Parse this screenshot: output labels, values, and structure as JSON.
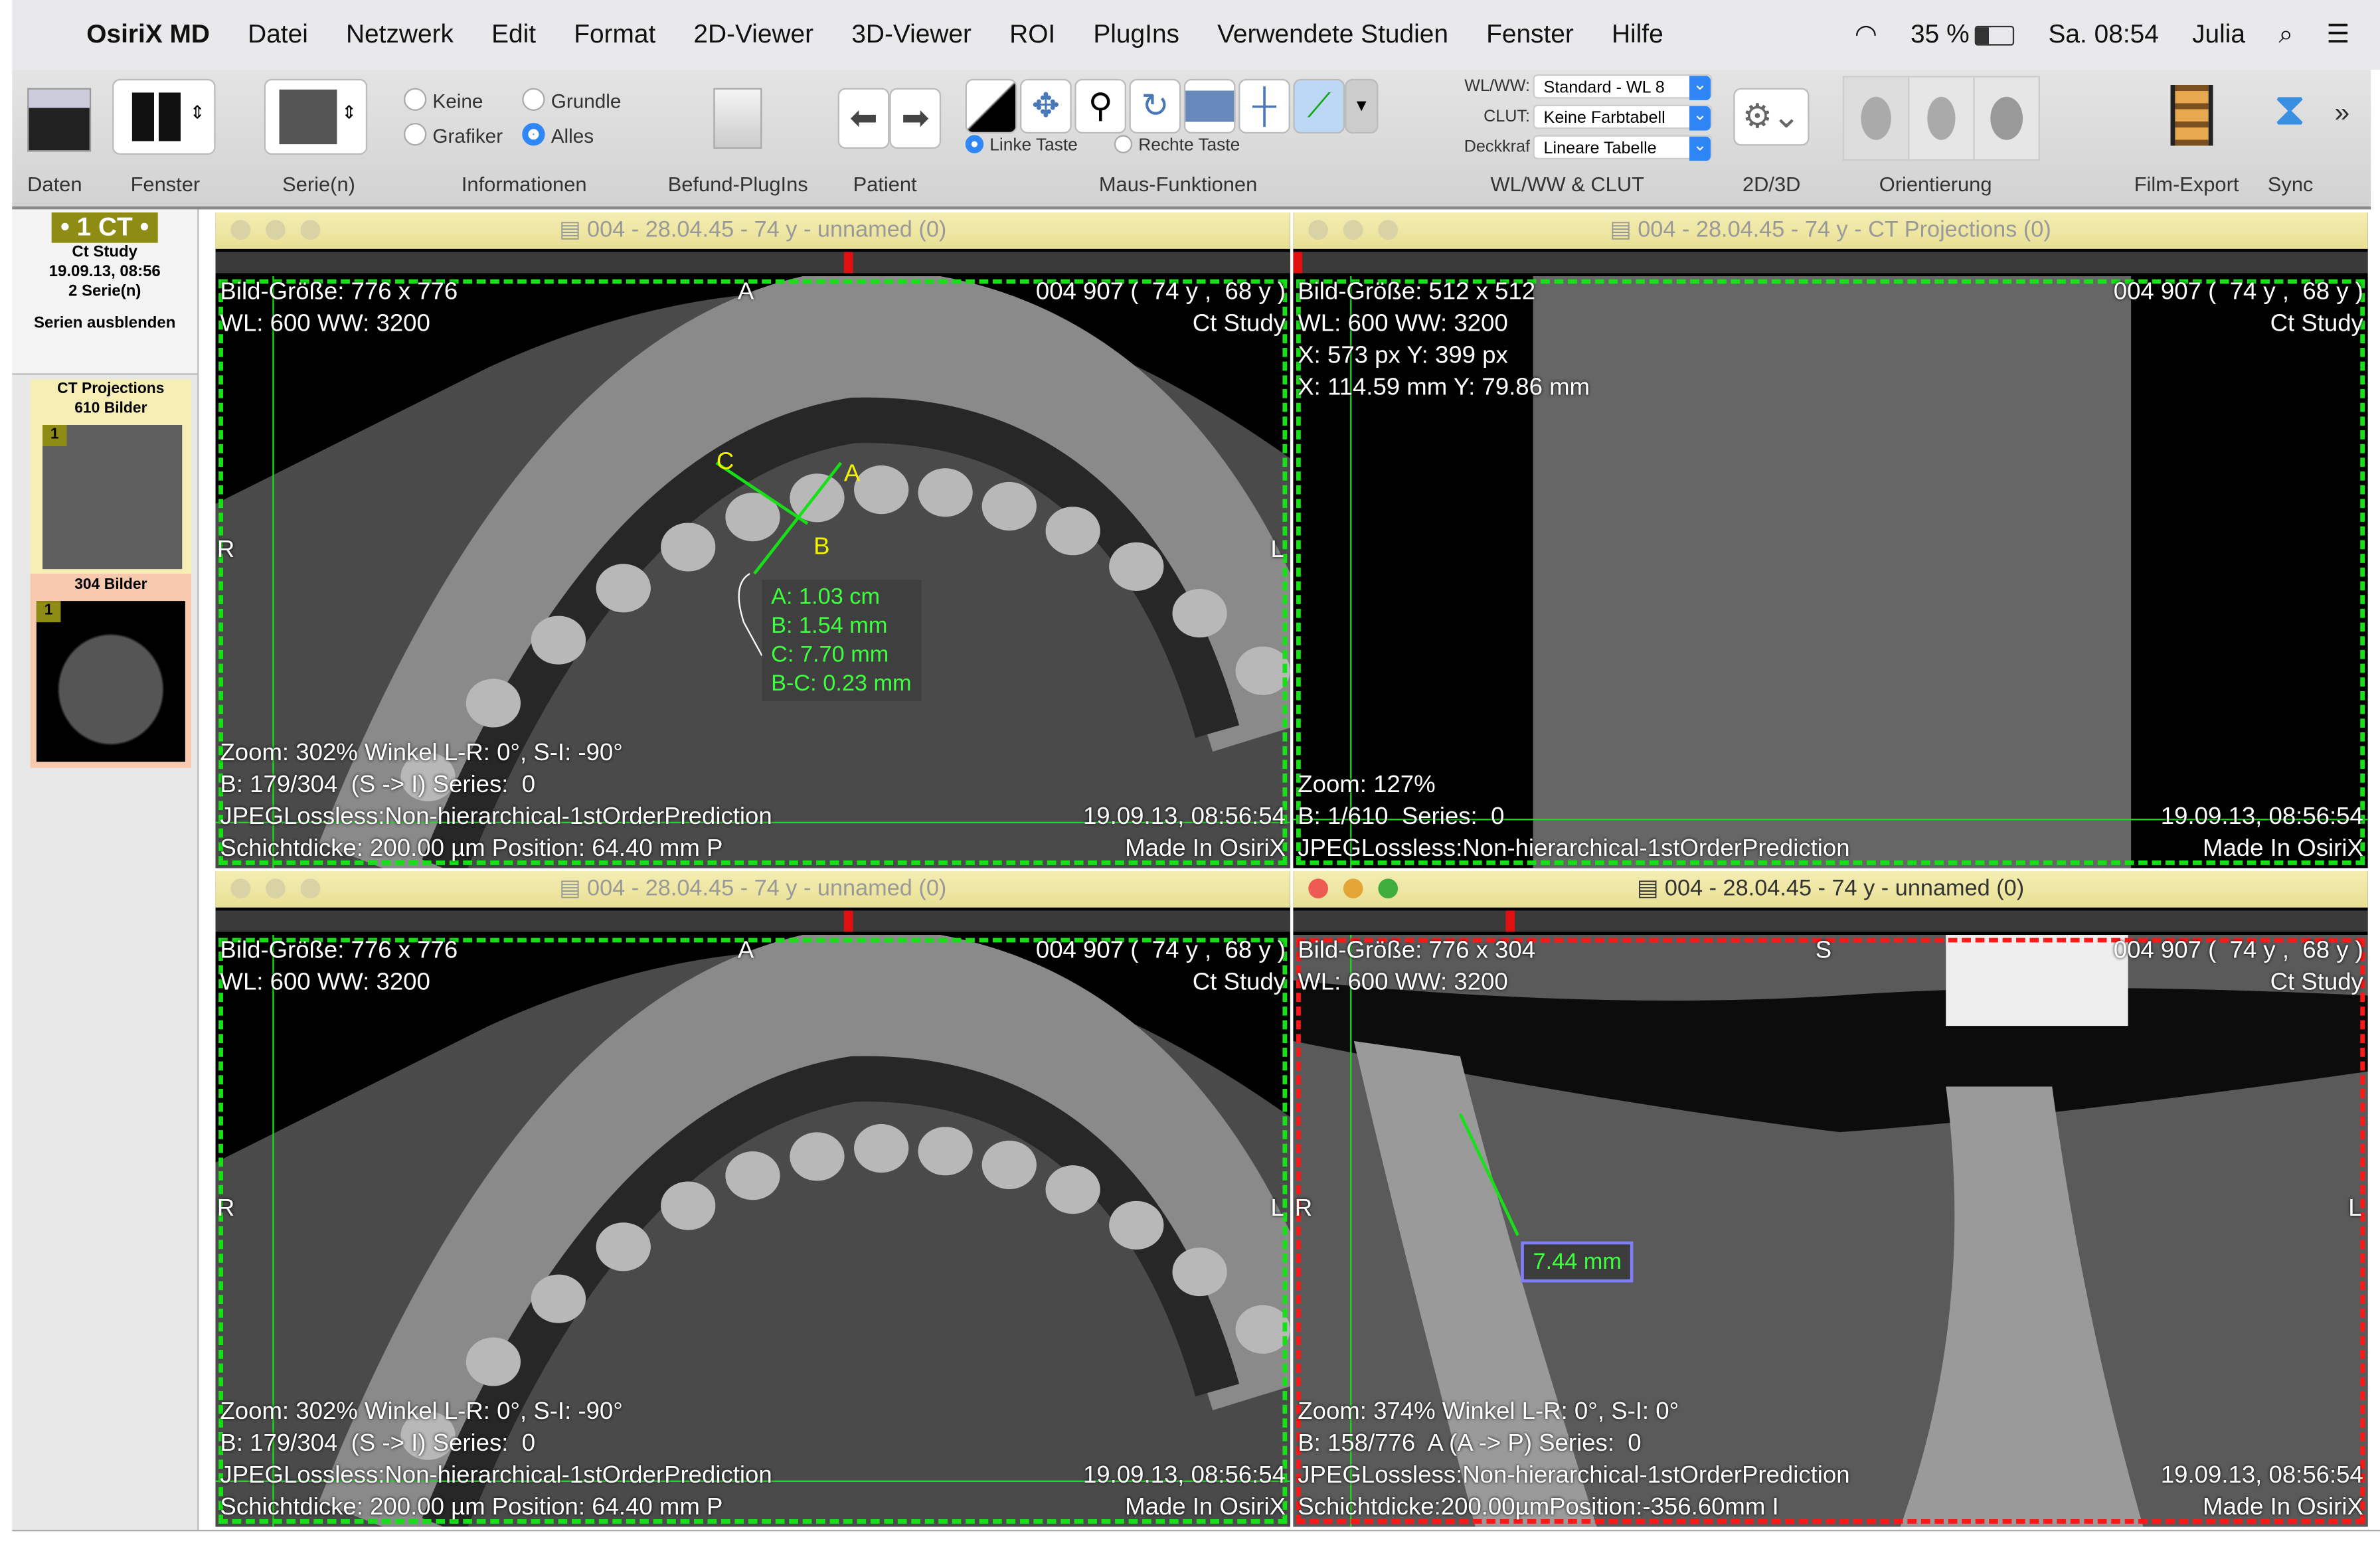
{
  "menubar": {
    "app": "OsiriX MD",
    "items": [
      "Datei",
      "Netzwerk",
      "Edit",
      "Format",
      "2D-Viewer",
      "3D-Viewer",
      "ROI",
      "PlugIns",
      "Verwendete Studien",
      "Fenster",
      "Hilfe"
    ],
    "battery": "35 %",
    "clock": "Sa. 08:54",
    "user": "Julia"
  },
  "toolbar": {
    "labels": [
      "Daten",
      "Fenster",
      "Serie(n)",
      "Informationen",
      "Befund-PlugIns",
      "Patient",
      "Maus-Funktionen",
      "WL/WW & CLUT",
      "2D/3D",
      "Orientierung",
      "Film-Export",
      "Sync"
    ],
    "info_radios": {
      "keine": "Keine",
      "grundle": "Grundle",
      "grafiker": "Grafiker",
      "alles": "Alles",
      "selected": "Alles"
    },
    "mouse_radios": {
      "left": "Linke Taste",
      "right": "Rechte Taste",
      "selected": "Linke Taste"
    },
    "wlww": {
      "wl_label": "WL/WW:",
      "wl_value": "Standard - WL 8",
      "clut_label": "CLUT:",
      "clut_value": "Keine Farbtabell",
      "opacity_label": "Deckkraf",
      "opacity_value": "Lineare Tabelle"
    },
    "more": "»"
  },
  "sidebar": {
    "badge": "• 1 CT •",
    "study": "Ct Study",
    "date": "19.09.13, 08:56",
    "series_count": "2 Serie(n)",
    "hide": "Serien ausblenden",
    "series": [
      {
        "name": "CT Projections",
        "count": "610 Bilder",
        "num": "1"
      },
      {
        "name": "",
        "count": "304 Bilder",
        "num": "1"
      }
    ]
  },
  "viewers": [
    {
      "title": "004 - 28.04.45 - 74 y - unnamed (0)",
      "active": false,
      "kind": "axial",
      "tl": "Bild-Größe: 776 x 776\nWL: 600 WW: 3200",
      "tr": "004 907 (  74 y ,  68 y )\nCt Study",
      "bl": "Zoom: 302% Winkel L-R: 0°, S-I: -90°\nB: 179/304  (S -> I) Series:  0\nJPEGLossless:Non-hierarchical-1stOrderPrediction\nSchichtdicke: 200.00 µm Position: 64.40 mm P",
      "br": "19.09.13, 08:56:54\nMade In OsiriX",
      "top": "A",
      "left": "R",
      "right": "L",
      "measure": "A: 1.03 cm\nB: 1.54 mm\nC: 7.70 mm\nB-C: 0.23 mm",
      "points": [
        "A",
        "B",
        "C"
      ]
    },
    {
      "title": "004 - 28.04.45 - 74 y - CT Projections (0)",
      "active": false,
      "kind": "proj",
      "tl": "Bild-Größe: 512 x 512\nWL: 600 WW: 3200\nX: 573 px Y: 399 px\nX: 114.59 mm Y: 79.86 mm",
      "tr": "004 907 (  74 y ,  68 y )\nCt Study",
      "bl": "Zoom: 127%\nB: 1/610  Series:  0\nJPEGLossless:Non-hierarchical-1stOrderPrediction",
      "br": "19.09.13, 08:56:54\nMade In OsiriX"
    },
    {
      "title": "004 - 28.04.45 - 74 y - unnamed (0)",
      "active": false,
      "kind": "axial",
      "tl": "Bild-Größe: 776 x 776\nWL: 600 WW: 3200",
      "tr": "004 907 (  74 y ,  68 y )\nCt Study",
      "bl": "Zoom: 302% Winkel L-R: 0°, S-I: -90°\nB: 179/304  (S -> I) Series:  0\nJPEGLossless:Non-hierarchical-1stOrderPrediction\nSchichtdicke: 200.00 µm Position: 64.40 mm P",
      "br": "19.09.13, 08:56:54\nMade In OsiriX",
      "top": "A",
      "left": "R",
      "right": "L"
    },
    {
      "title": "004 - 28.04.45 - 74 y - unnamed (0)",
      "active": true,
      "kind": "coronal",
      "tl": "Bild-Größe: 776 x 304\nWL: 600 WW: 3200",
      "tr": "004 907 (  74 y ,  68 y )\nCt Study",
      "bl": "Zoom: 374% Winkel L-R: 0°, S-I: 0°\nB: 158/776  A (A -> P) Series:  0\nJPEGLossless:Non-hierarchical-1stOrderPrediction\nSchichtdicke:200.00µmPosition:-356.60mm I",
      "br": "19.09.13, 08:56:54\nMade In OsiriX",
      "top": "S",
      "left": "R",
      "right": "L",
      "length": "7.44 mm"
    }
  ]
}
